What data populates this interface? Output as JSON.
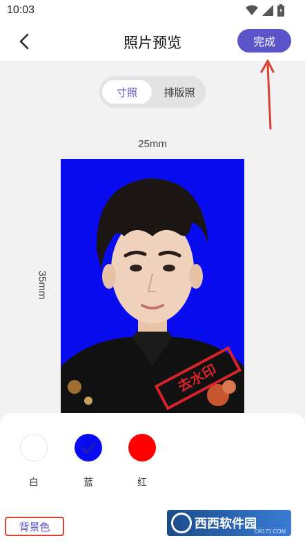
{
  "status_bar": {
    "time": "10:03"
  },
  "header": {
    "title": "照片预览",
    "done_label": "完成"
  },
  "tabs": [
    {
      "label": "寸照",
      "active": true
    },
    {
      "label": "排版照",
      "active": false
    }
  ],
  "photo": {
    "width_label": "25mm",
    "height_label": "35mm",
    "background_color": "#0a0cf0",
    "stamp_text": "去水印"
  },
  "background_colors": [
    {
      "label": "白",
      "color": "#ffffff",
      "selected": false
    },
    {
      "label": "蓝",
      "color": "#0a0cf0",
      "selected": true
    },
    {
      "label": "红",
      "color": "#ff0000",
      "selected": false
    }
  ],
  "bottom_tab": {
    "label": "背景色"
  },
  "watermark": {
    "text": "西西软件园",
    "sub": "CR173.COM"
  },
  "colors": {
    "accent": "#5b55c9",
    "annotation": "#d9412e"
  }
}
